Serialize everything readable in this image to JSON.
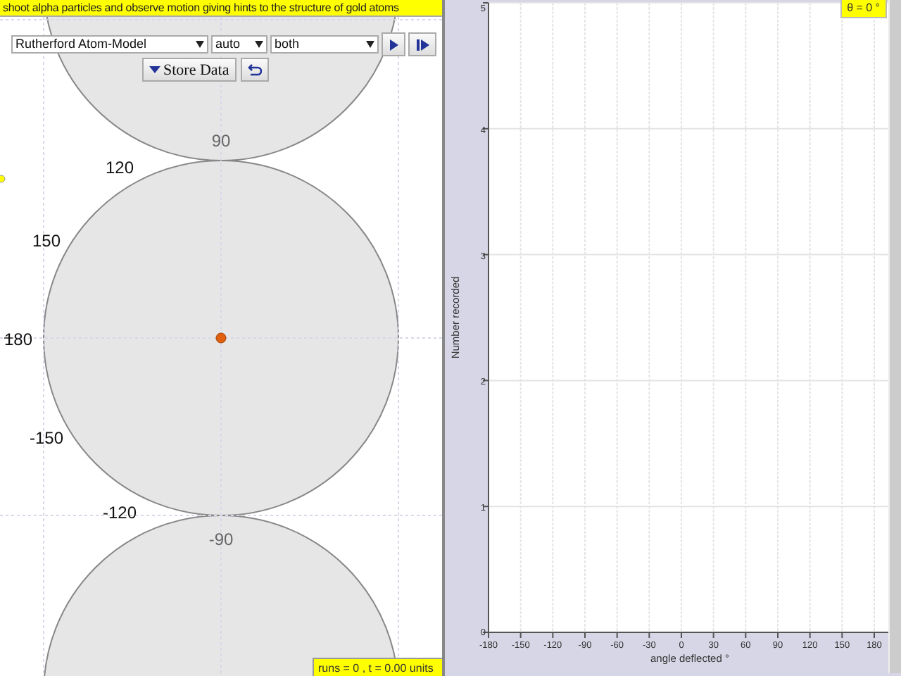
{
  "header": {
    "text": "shoot alpha particles and observe motion giving hints to the structure of gold atoms"
  },
  "controls": {
    "model_select": "Rutherford Atom-Model",
    "mode_select": "auto",
    "view_select": "both",
    "store_button": "Store Data"
  },
  "canvas": {
    "angle_labels": [
      {
        "text": "90",
        "kind": "pole"
      },
      {
        "text": "120",
        "kind": "ring"
      },
      {
        "text": "150",
        "kind": "ring"
      },
      {
        "text": "180",
        "kind": "ring"
      },
      {
        "text": "-150",
        "kind": "ring"
      },
      {
        "text": "-120",
        "kind": "ring"
      },
      {
        "text": "-90",
        "kind": "pole"
      }
    ]
  },
  "status": "runs = 0 , t = 0.00 units",
  "histogram": {
    "theta": "θ = 0 °",
    "chart_data": {
      "type": "histogram",
      "xlabel": "angle deflected °",
      "ylabel": "Number recorded",
      "xlim": [
        -180,
        180
      ],
      "ylim": [
        0,
        5
      ],
      "xticks": [
        -180,
        -150,
        -120,
        -90,
        -60,
        -30,
        0,
        30,
        60,
        90,
        120,
        150,
        180
      ],
      "yticks": [
        0,
        1,
        2,
        3,
        4,
        5
      ],
      "grid": true
    }
  }
}
